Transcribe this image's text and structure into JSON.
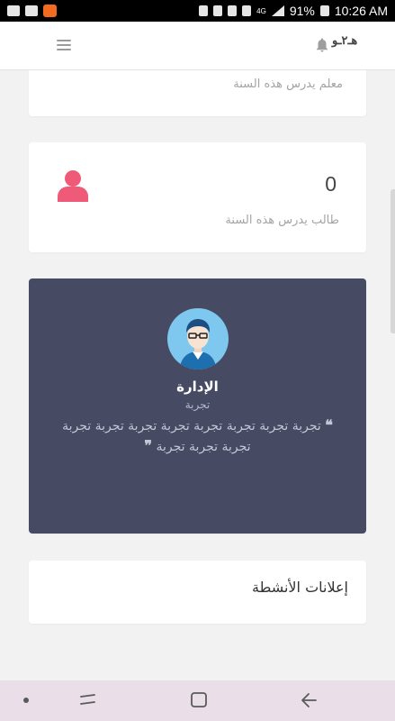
{
  "status_bar": {
    "battery": "91%",
    "time": "10:26 AM",
    "network": "4G"
  },
  "app_bar": {
    "brand": "هـ٢ـو"
  },
  "cards": {
    "teachers": {
      "label": "معلم يدرس هذه السنة"
    },
    "students": {
      "count": "0",
      "label": "طالب يدرس هذه السنة"
    },
    "admin": {
      "name": "الإدارة",
      "role": "تجربة",
      "quote": "تجربة تجربة تجربة تجربة تجربة تجربة تجربة تجربة تجربة تجربة تجربة"
    },
    "activities": {
      "title": "إعلانات الأنشطة"
    }
  },
  "colors": {
    "admin_card_bg": "#464a63",
    "user_icon": "#ee5a78",
    "avatar_bg": "#7ec7ee"
  }
}
